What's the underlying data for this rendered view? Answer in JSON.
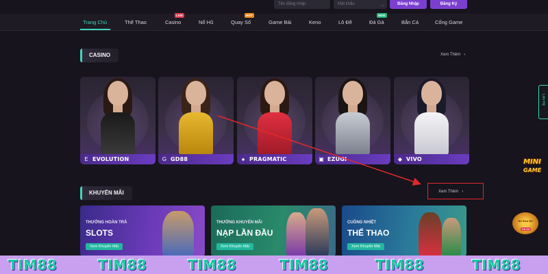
{
  "auth": {
    "username_placeholder": "Tên đăng nhập",
    "password_placeholder": "Mật khẩu",
    "login_label": "Đăng Nhập",
    "register_label": "Đăng Ký"
  },
  "nav": {
    "items": [
      {
        "label": "Trang Chủ",
        "active": true
      },
      {
        "label": "Thể Thao"
      },
      {
        "label": "Casino",
        "badge": "LIVE"
      },
      {
        "label": "Nổ Hũ"
      },
      {
        "label": "Quay Số",
        "badge": "HOT"
      },
      {
        "label": "Game Bài"
      },
      {
        "label": "Keno"
      },
      {
        "label": "Lô Đề"
      },
      {
        "label": "Đá Gà",
        "badge": "NEW"
      },
      {
        "label": "Bắn Cá"
      },
      {
        "label": "Cổng Game"
      }
    ]
  },
  "casino": {
    "title": "CASINO",
    "see_more": "Xem Thêm",
    "providers": [
      {
        "name": "EVOLUTION",
        "logo": "E"
      },
      {
        "name": "GD88",
        "logo": "G"
      },
      {
        "name": "PRAGMATIC",
        "logo": "♠"
      },
      {
        "name": "EZUGI",
        "logo": "▣"
      },
      {
        "name": "VIVO",
        "logo": "◆"
      }
    ]
  },
  "promo": {
    "title": "KHUYẾN MÃI",
    "see_more": "Xem Thêm",
    "cards": [
      {
        "subtitle": "THƯỞNG HOÀN TRẢ",
        "title": "SLOTS",
        "button": "Xem Khuyến Mãi"
      },
      {
        "subtitle": "THƯỞNG KHUYẾN MÃI",
        "title": "NẠP LẦN ĐẦU",
        "button": "Xem Khuyến Mãi"
      },
      {
        "subtitle": "CUỒNG NHIỆT",
        "title": "THỂ THAO",
        "button": "Xem Khuyến Mãi"
      }
    ]
  },
  "side": {
    "tab_label": "Liên Hệ",
    "mini_game_line1": "MINI",
    "mini_game_line2": "GAME",
    "jackpot_label": "Hũ Siêu Nổ",
    "jackpot_badge": "Đã Nổ"
  },
  "watermark": {
    "text": "TIM88"
  },
  "colors": {
    "accent": "#3fd6b8",
    "primary_button": "#7b3fd0",
    "background": "#17141d",
    "annotation": "#e02a2a",
    "watermark_band": "#c9a0f0"
  }
}
